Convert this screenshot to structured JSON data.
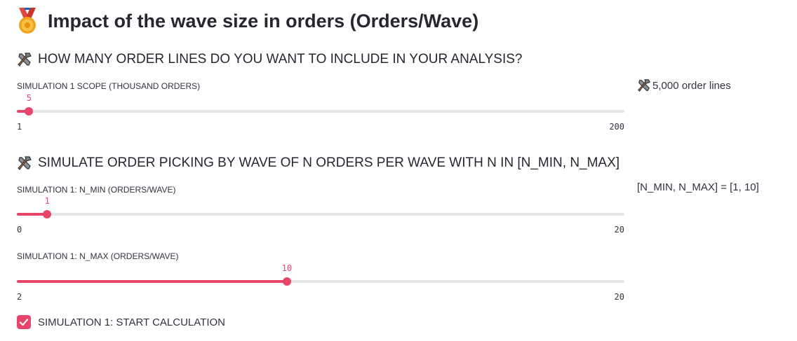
{
  "header": {
    "title": "Impact of the wave size in orders (Orders/Wave)",
    "icon": "medal-icon"
  },
  "accent_color": "#e8456b",
  "section1": {
    "heading": "HOW MANY ORDER LINES DO YOU WANT TO INCLUDE IN YOUR ANALYSIS?",
    "icon": "hammer-wrench-icon",
    "slider": {
      "label": "SIMULATION 1 SCOPE (THOUSAND ORDERS)",
      "value": 5,
      "min": 1,
      "max": 200,
      "value_text": "5",
      "min_text": "1",
      "max_text": "200"
    },
    "side_text": "5,000 order lines"
  },
  "section2": {
    "heading": "SIMULATE ORDER PICKING BY WAVE OF N ORDERS PER WAVE WITH N IN [N_MIN, N_MAX]",
    "icon": "hammer-wrench-icon",
    "slider_min": {
      "label": "SIMULATION 1: N_MIN (ORDERS/WAVE)",
      "value": 1,
      "min": 0,
      "max": 20,
      "value_text": "1",
      "min_text": "0",
      "max_text": "20"
    },
    "slider_max": {
      "label": "SIMULATION 1: N_MAX (ORDERS/WAVE)",
      "value": 10,
      "min": 2,
      "max": 20,
      "value_text": "10",
      "min_text": "2",
      "max_text": "20"
    },
    "side_text": "[N_MIN, N_MAX] = [1, 10]"
  },
  "checkbox": {
    "label": "SIMULATION 1: START CALCULATION",
    "checked": true
  }
}
